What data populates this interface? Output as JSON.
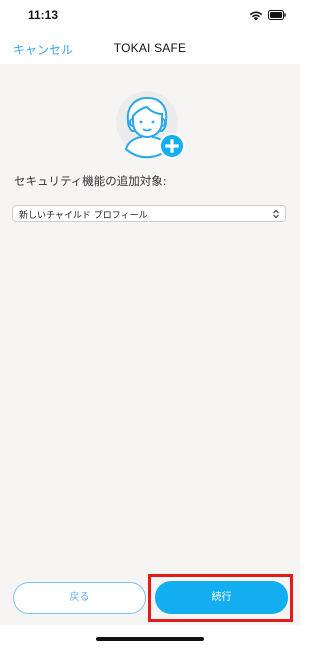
{
  "status_bar": {
    "time": "11:13",
    "wifi_icon": "wifi-icon",
    "battery_icon": "battery-icon"
  },
  "nav": {
    "cancel_label": "キャンセル",
    "title": "TOKAI SAFE"
  },
  "main": {
    "avatar_icon": "child-avatar-add-icon",
    "prompt_label": "セキュリティ機能の追加対象:",
    "select": {
      "selected_value": "新しいチャイルド プロフィール",
      "chevron_icon": "up-down-chevron-icon"
    }
  },
  "footer": {
    "back_label": "戻る",
    "continue_label": "続行"
  },
  "colors": {
    "accent": "#12aef0",
    "link": "#3da4f0",
    "highlight": "#e21b1b",
    "content_bg": "#f7f4f4"
  }
}
